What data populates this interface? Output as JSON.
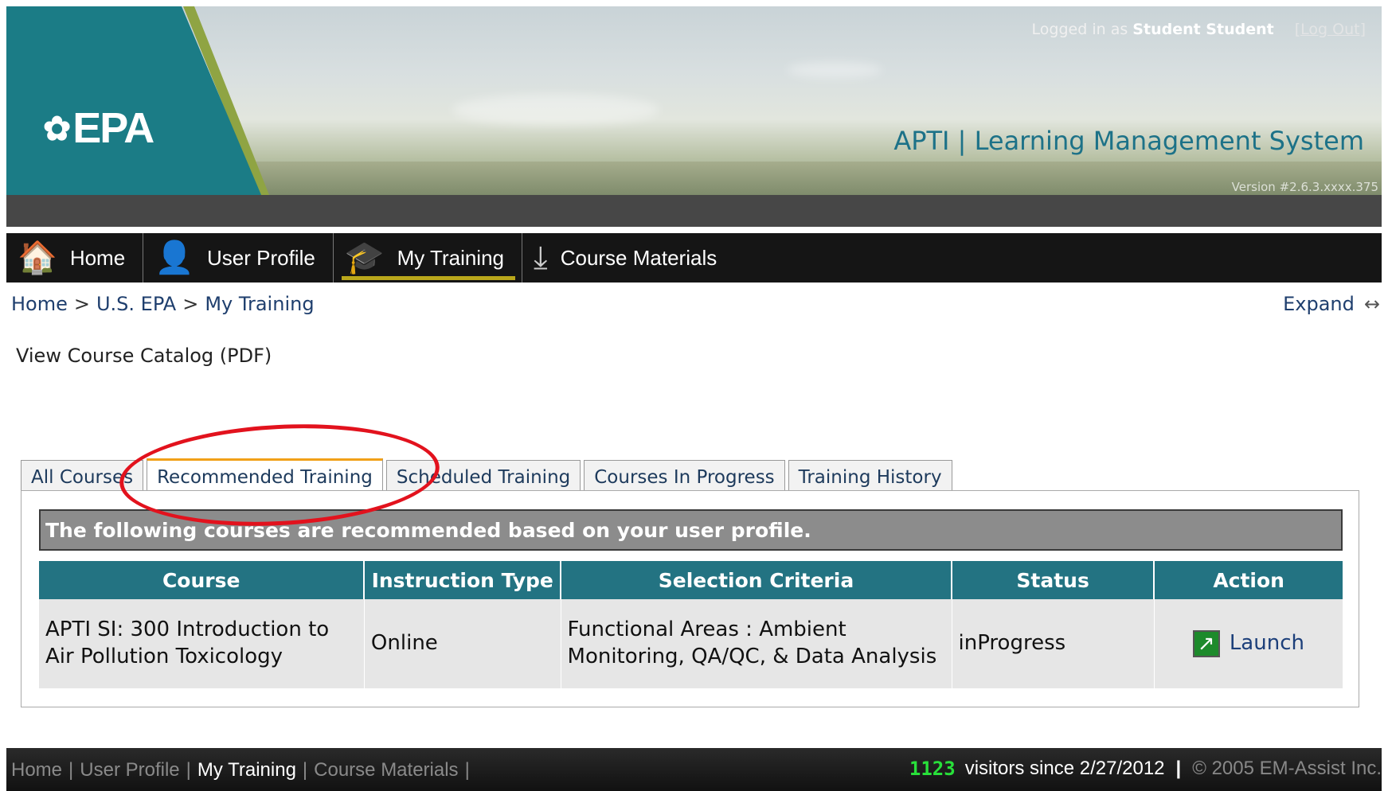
{
  "header": {
    "logged_in_prefix": "Logged in as",
    "user_name": "Student Student",
    "logout_label": "[Log Out]",
    "logo_text": "EPA",
    "site_title": "APTI | Learning Management System",
    "version": "Version #2.6.3.xxxx.375"
  },
  "nav": {
    "items": [
      {
        "label": "Home",
        "icon": "home-icon"
      },
      {
        "label": "User Profile",
        "icon": "user-icon"
      },
      {
        "label": "My Training",
        "icon": "graduation-cap-icon",
        "active": true
      },
      {
        "label": "Course Materials",
        "icon": "download-icon"
      }
    ]
  },
  "breadcrumb": {
    "items": [
      "Home",
      "U.S. EPA",
      "My Training"
    ],
    "separator": ">"
  },
  "expand": {
    "label": "Expand",
    "icon": "left-right-arrow-icon"
  },
  "catalog_link": "View Course Catalog (PDF)",
  "tabs": [
    {
      "label": "All Courses"
    },
    {
      "label": "Recommended Training",
      "active": true
    },
    {
      "label": "Scheduled Training"
    },
    {
      "label": "Courses In Progress"
    },
    {
      "label": "Training History"
    }
  ],
  "panel": {
    "message": "The following courses are recommended based on your user profile.",
    "table": {
      "columns": [
        "Course",
        "Instruction Type",
        "Selection Criteria",
        "Status",
        "Action"
      ],
      "rows": [
        {
          "course": "APTI SI: 300 Introduction to Air Pollution Toxicology",
          "instruction_type": "Online",
          "selection_criteria": "Functional Areas : Ambient Monitoring, QA/QC, & Data Analysis",
          "status": "inProgress",
          "action": "Launch"
        }
      ]
    }
  },
  "footer": {
    "links": [
      "Home",
      "User Profile",
      "My Training",
      "Course Materials"
    ],
    "active_link": "My Training",
    "visitor_count": "1123",
    "visitors_label": "visitors since  2/27/2012",
    "copyright": "© 2005 EM-Assist Inc."
  },
  "colors": {
    "teal": "#1b7c86",
    "table_header": "#237382",
    "active_tab_accent": "#f1a018",
    "annotation": "#e2121d",
    "visitor_counter": "#28e03a"
  }
}
